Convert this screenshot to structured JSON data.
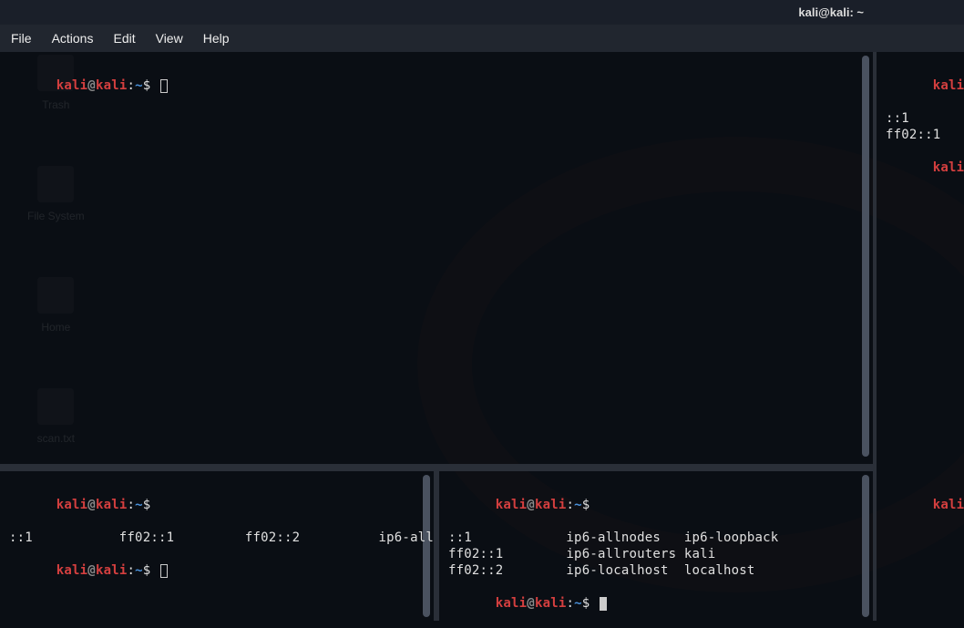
{
  "window": {
    "title": "kali@kali: ~"
  },
  "menu": {
    "file": "File",
    "actions": "Actions",
    "edit": "Edit",
    "view": "View",
    "help": "Help"
  },
  "desktop": {
    "trash": "Trash",
    "filesystem": "File System",
    "home": "Home",
    "scan": "scan.txt"
  },
  "prompt": {
    "user": "kali",
    "at": "@",
    "host": "kali",
    "colon": ":",
    "path": "~",
    "dollar": "$"
  },
  "panes": {
    "top_right": {
      "line1": "::1",
      "line2": "ff02::1"
    },
    "bot_left": {
      "out": "::1           ff02::1         ff02::2          ip6-all"
    },
    "bot_mid": {
      "l1": "::1            ip6-allnodes   ip6-loopback",
      "l2": "ff02::1        ip6-allrouters kali",
      "l3": "ff02::2        ip6-localhost  localhost"
    }
  }
}
